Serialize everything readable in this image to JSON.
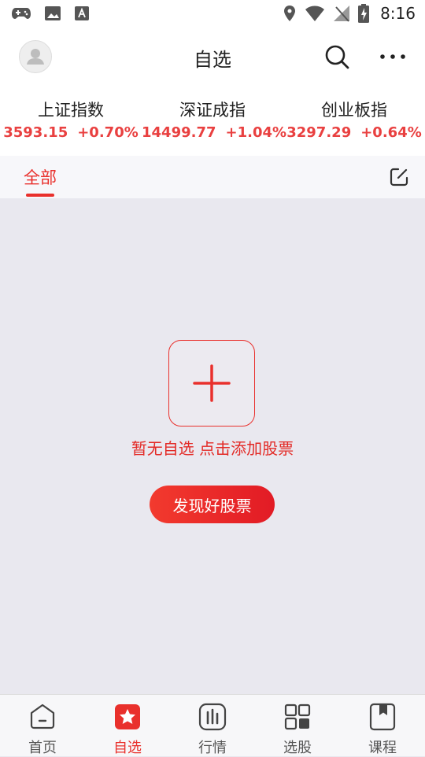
{
  "status_bar": {
    "time": "8:16"
  },
  "header": {
    "title": "自选"
  },
  "indices": [
    {
      "name": "上证指数",
      "value": "3593.15",
      "change": "+0.70%"
    },
    {
      "name": "深证成指",
      "value": "14499.77",
      "change": "+1.04%"
    },
    {
      "name": "创业板指",
      "value": "3297.29",
      "change": "+0.64%"
    }
  ],
  "tabs": {
    "active_label": "全部"
  },
  "empty_state": {
    "message": "暂无自选 点击添加股票",
    "button_label": "发现好股票"
  },
  "bottom_nav": [
    {
      "label": "首页"
    },
    {
      "label": "自选"
    },
    {
      "label": "行情"
    },
    {
      "label": "选股"
    },
    {
      "label": "课程"
    }
  ],
  "colors": {
    "accent": "#e9302c",
    "up": "#e94040",
    "background": "#e9e8ef"
  }
}
